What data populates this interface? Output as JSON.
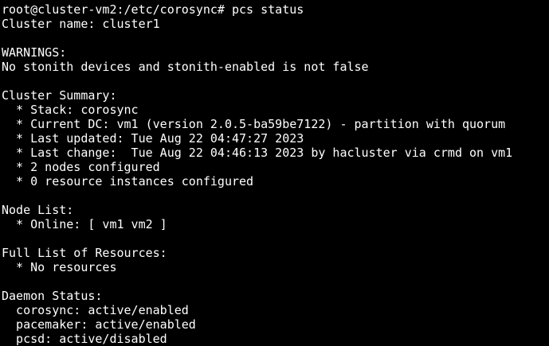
{
  "terminal": {
    "text_color": "#ffffff",
    "background_color": "#000000",
    "lines": [
      "root@cluster-vm2:/etc/corosync# pcs status",
      "Cluster name: cluster1",
      "",
      "WARNINGS:",
      "No stonith devices and stonith-enabled is not false",
      "",
      "Cluster Summary:",
      "  * Stack: corosync",
      "  * Current DC: vm1 (version 2.0.5-ba59be7122) - partition with quorum",
      "  * Last updated: Tue Aug 22 04:47:27 2023",
      "  * Last change:  Tue Aug 22 04:46:13 2023 by hacluster via crmd on vm1",
      "  * 2 nodes configured",
      "  * 0 resource instances configured",
      "",
      "Node List:",
      "  * Online: [ vm1 vm2 ]",
      "",
      "Full List of Resources:",
      "  * No resources",
      "",
      "Daemon Status:",
      "  corosync: active/enabled",
      "  pacemaker: active/enabled",
      "  pcsd: active/disabled"
    ]
  }
}
